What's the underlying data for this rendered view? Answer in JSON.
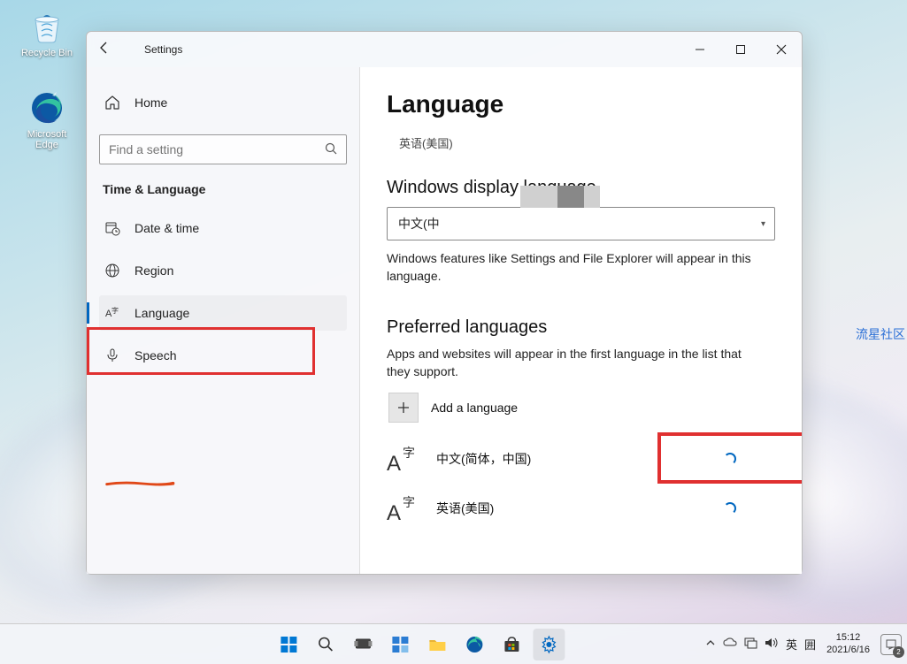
{
  "desktop": {
    "recycle_bin": "Recycle Bin",
    "edge": "Microsoft Edge"
  },
  "window": {
    "title": "Settings",
    "back_icon": "←"
  },
  "sidebar": {
    "home": "Home",
    "search_placeholder": "Find a setting",
    "section": "Time & Language",
    "items": [
      {
        "label": "Date & time",
        "icon": "clock"
      },
      {
        "label": "Region",
        "icon": "globe"
      },
      {
        "label": "Language",
        "icon": "lang"
      },
      {
        "label": "Speech",
        "icon": "mic"
      }
    ]
  },
  "main": {
    "title": "Language",
    "breadcrumb": "英语(美国)",
    "display_heading": "Windows display language",
    "display_value": "中文(中",
    "display_caption": "Windows features like Settings and File Explorer will appear in this language.",
    "preferred_heading": "Preferred languages",
    "preferred_caption": "Apps and websites will appear in the first language in the list that they support.",
    "add_label": "Add a language",
    "languages": [
      {
        "label": "中文(简体，中国)"
      },
      {
        "label": "英语(美国)"
      }
    ]
  },
  "watermark": "流星社区",
  "taskbar": {
    "ime_lang": "英",
    "ime_mode": "囲",
    "time": "15:12",
    "date": "2021/6/16",
    "notif_count": "2"
  }
}
